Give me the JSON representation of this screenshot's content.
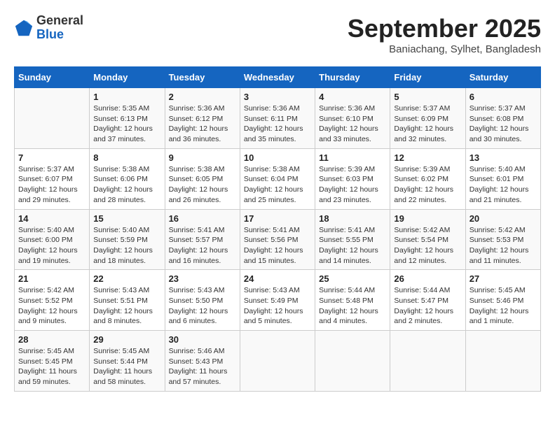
{
  "logo": {
    "general": "General",
    "blue": "Blue"
  },
  "header": {
    "month": "September 2025",
    "location": "Baniachang, Sylhet, Bangladesh"
  },
  "days_of_week": [
    "Sunday",
    "Monday",
    "Tuesday",
    "Wednesday",
    "Thursday",
    "Friday",
    "Saturday"
  ],
  "weeks": [
    [
      {
        "day": "",
        "info": ""
      },
      {
        "day": "1",
        "info": "Sunrise: 5:35 AM\nSunset: 6:13 PM\nDaylight: 12 hours\nand 37 minutes."
      },
      {
        "day": "2",
        "info": "Sunrise: 5:36 AM\nSunset: 6:12 PM\nDaylight: 12 hours\nand 36 minutes."
      },
      {
        "day": "3",
        "info": "Sunrise: 5:36 AM\nSunset: 6:11 PM\nDaylight: 12 hours\nand 35 minutes."
      },
      {
        "day": "4",
        "info": "Sunrise: 5:36 AM\nSunset: 6:10 PM\nDaylight: 12 hours\nand 33 minutes."
      },
      {
        "day": "5",
        "info": "Sunrise: 5:37 AM\nSunset: 6:09 PM\nDaylight: 12 hours\nand 32 minutes."
      },
      {
        "day": "6",
        "info": "Sunrise: 5:37 AM\nSunset: 6:08 PM\nDaylight: 12 hours\nand 30 minutes."
      }
    ],
    [
      {
        "day": "7",
        "info": "Sunrise: 5:37 AM\nSunset: 6:07 PM\nDaylight: 12 hours\nand 29 minutes."
      },
      {
        "day": "8",
        "info": "Sunrise: 5:38 AM\nSunset: 6:06 PM\nDaylight: 12 hours\nand 28 minutes."
      },
      {
        "day": "9",
        "info": "Sunrise: 5:38 AM\nSunset: 6:05 PM\nDaylight: 12 hours\nand 26 minutes."
      },
      {
        "day": "10",
        "info": "Sunrise: 5:38 AM\nSunset: 6:04 PM\nDaylight: 12 hours\nand 25 minutes."
      },
      {
        "day": "11",
        "info": "Sunrise: 5:39 AM\nSunset: 6:03 PM\nDaylight: 12 hours\nand 23 minutes."
      },
      {
        "day": "12",
        "info": "Sunrise: 5:39 AM\nSunset: 6:02 PM\nDaylight: 12 hours\nand 22 minutes."
      },
      {
        "day": "13",
        "info": "Sunrise: 5:40 AM\nSunset: 6:01 PM\nDaylight: 12 hours\nand 21 minutes."
      }
    ],
    [
      {
        "day": "14",
        "info": "Sunrise: 5:40 AM\nSunset: 6:00 PM\nDaylight: 12 hours\nand 19 minutes."
      },
      {
        "day": "15",
        "info": "Sunrise: 5:40 AM\nSunset: 5:59 PM\nDaylight: 12 hours\nand 18 minutes."
      },
      {
        "day": "16",
        "info": "Sunrise: 5:41 AM\nSunset: 5:57 PM\nDaylight: 12 hours\nand 16 minutes."
      },
      {
        "day": "17",
        "info": "Sunrise: 5:41 AM\nSunset: 5:56 PM\nDaylight: 12 hours\nand 15 minutes."
      },
      {
        "day": "18",
        "info": "Sunrise: 5:41 AM\nSunset: 5:55 PM\nDaylight: 12 hours\nand 14 minutes."
      },
      {
        "day": "19",
        "info": "Sunrise: 5:42 AM\nSunset: 5:54 PM\nDaylight: 12 hours\nand 12 minutes."
      },
      {
        "day": "20",
        "info": "Sunrise: 5:42 AM\nSunset: 5:53 PM\nDaylight: 12 hours\nand 11 minutes."
      }
    ],
    [
      {
        "day": "21",
        "info": "Sunrise: 5:42 AM\nSunset: 5:52 PM\nDaylight: 12 hours\nand 9 minutes."
      },
      {
        "day": "22",
        "info": "Sunrise: 5:43 AM\nSunset: 5:51 PM\nDaylight: 12 hours\nand 8 minutes."
      },
      {
        "day": "23",
        "info": "Sunrise: 5:43 AM\nSunset: 5:50 PM\nDaylight: 12 hours\nand 6 minutes."
      },
      {
        "day": "24",
        "info": "Sunrise: 5:43 AM\nSunset: 5:49 PM\nDaylight: 12 hours\nand 5 minutes."
      },
      {
        "day": "25",
        "info": "Sunrise: 5:44 AM\nSunset: 5:48 PM\nDaylight: 12 hours\nand 4 minutes."
      },
      {
        "day": "26",
        "info": "Sunrise: 5:44 AM\nSunset: 5:47 PM\nDaylight: 12 hours\nand 2 minutes."
      },
      {
        "day": "27",
        "info": "Sunrise: 5:45 AM\nSunset: 5:46 PM\nDaylight: 12 hours\nand 1 minute."
      }
    ],
    [
      {
        "day": "28",
        "info": "Sunrise: 5:45 AM\nSunset: 5:45 PM\nDaylight: 11 hours\nand 59 minutes."
      },
      {
        "day": "29",
        "info": "Sunrise: 5:45 AM\nSunset: 5:44 PM\nDaylight: 11 hours\nand 58 minutes."
      },
      {
        "day": "30",
        "info": "Sunrise: 5:46 AM\nSunset: 5:43 PM\nDaylight: 11 hours\nand 57 minutes."
      },
      {
        "day": "",
        "info": ""
      },
      {
        "day": "",
        "info": ""
      },
      {
        "day": "",
        "info": ""
      },
      {
        "day": "",
        "info": ""
      }
    ]
  ]
}
